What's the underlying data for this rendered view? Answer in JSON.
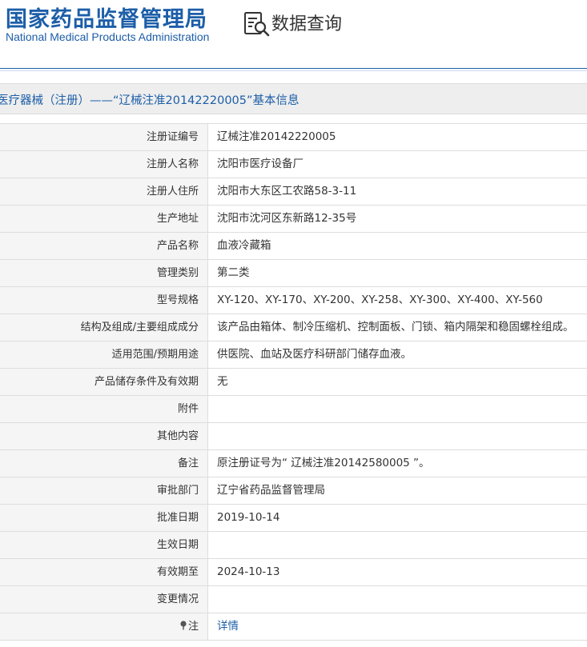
{
  "header": {
    "brand_cn": "国家药品监督管理局",
    "brand_en": "National Medical Products Administration",
    "query_title": "数据查询",
    "query_icon": "search-document-icon"
  },
  "title_bar": {
    "text": "医疗器械（注册）——“辽械注准20142220005”基本信息"
  },
  "rows": [
    {
      "label": "注册证编号",
      "value": "辽械注准20142220005"
    },
    {
      "label": "注册人名称",
      "value": "沈阳市医疗设备厂"
    },
    {
      "label": "注册人住所",
      "value": "沈阳市大东区工农路58-3-11"
    },
    {
      "label": "生产地址",
      "value": "沈阳市沈河区东新路12-35号"
    },
    {
      "label": "产品名称",
      "value": "血液冷藏箱"
    },
    {
      "label": "管理类别",
      "value": "第二类"
    },
    {
      "label": "型号规格",
      "value": "XY-120、XY-170、XY-200、XY-258、XY-300、XY-400、XY-560"
    },
    {
      "label": "结构及组成/主要组成成分",
      "value": "该产品由箱体、制冷压缩机、控制面板、门锁、箱内隔架和稳固螺栓组成。"
    },
    {
      "label": "适用范围/预期用途",
      "value": "供医院、血站及医疗科研部门储存血液。"
    },
    {
      "label": "产品储存条件及有效期",
      "value": "无"
    },
    {
      "label": "附件",
      "value": ""
    },
    {
      "label": "其他内容",
      "value": ""
    },
    {
      "label": "备注",
      "value": "原注册证号为“ 辽械注准20142580005 ”。"
    },
    {
      "label": "审批部门",
      "value": "辽宁省药品监督管理局"
    },
    {
      "label": "批准日期",
      "value": "2019-10-14"
    },
    {
      "label": "生效日期",
      "value": ""
    },
    {
      "label": "有效期至",
      "value": "2024-10-13"
    },
    {
      "label": "变更情况",
      "value": ""
    },
    {
      "label": "注",
      "value": "详情",
      "icon": "pin-icon"
    }
  ],
  "colors": {
    "brand_blue": "#1c5ea8",
    "label_bg": "#f5f5f5",
    "border": "#dddddd"
  }
}
